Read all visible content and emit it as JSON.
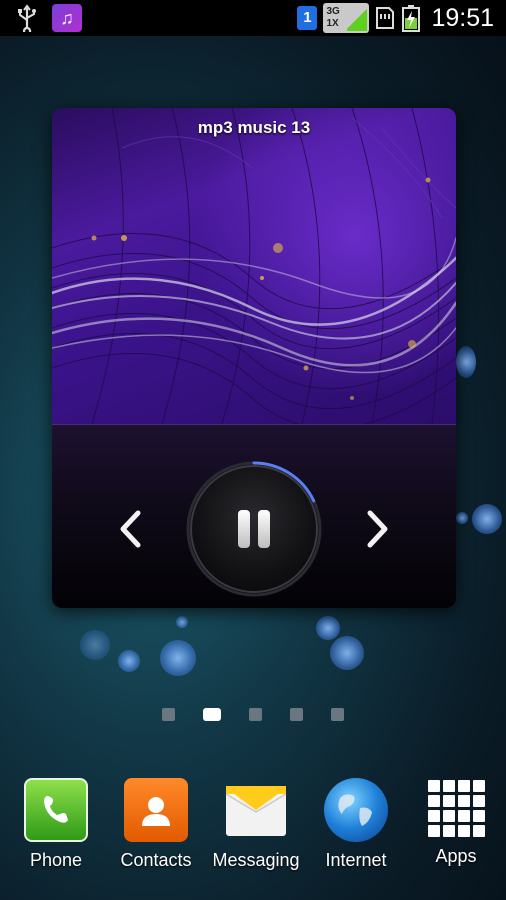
{
  "status_bar": {
    "icons": [
      "usb-icon",
      "music-note-icon",
      "sim-badge",
      "network-badge",
      "sd-card-icon",
      "battery-charging-icon"
    ],
    "sim_label": "1",
    "network_top": "3G",
    "network_bottom": "1X",
    "time": "19:51"
  },
  "music_widget": {
    "track_title": "mp3 music 13",
    "progress": 0.18,
    "controls": [
      "prev-icon",
      "pause-icon",
      "next-icon"
    ],
    "prev_glyph": "‹",
    "next_glyph": "›"
  },
  "home": {
    "page_count": 5,
    "active_page": 2
  },
  "dock": {
    "items": [
      {
        "label": "Phone",
        "icon": "phone-icon"
      },
      {
        "label": "Contacts",
        "icon": "contacts-icon"
      },
      {
        "label": "Messaging",
        "icon": "envelope-icon"
      },
      {
        "label": "Internet",
        "icon": "globe-icon"
      },
      {
        "label": "Apps",
        "icon": "apps-grid-icon"
      }
    ]
  }
}
